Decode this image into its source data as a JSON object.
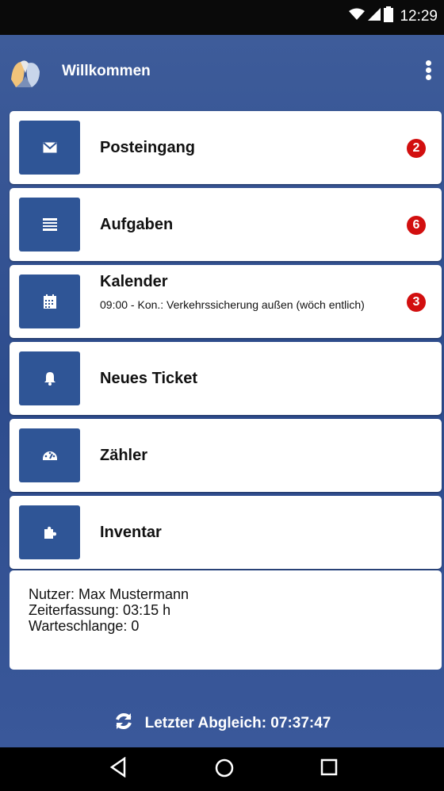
{
  "status_bar": {
    "time": "12:29",
    "icons": [
      "wifi-icon",
      "signal-icon",
      "battery-icon"
    ]
  },
  "app_bar": {
    "title": "Willkommen",
    "logo_icon": "hands-logo-icon",
    "menu_icon": "overflow-menu-icon"
  },
  "menu": [
    {
      "label": "Posteingang",
      "icon": "envelope-icon",
      "badge": "2"
    },
    {
      "label": "Aufgaben",
      "icon": "list-icon",
      "badge": "6"
    },
    {
      "label": "Kalender",
      "icon": "calendar-icon",
      "badge": "3",
      "subtitle": "09:00 - Kon.: Verkehrssicherung außen (wöch entlich)"
    },
    {
      "label": "Neues Ticket",
      "icon": "bell-icon"
    },
    {
      "label": "Zähler",
      "icon": "gauge-icon"
    },
    {
      "label": "Inventar",
      "icon": "puzzle-icon"
    }
  ],
  "info": {
    "user_line": "Nutzer: Max Mustermann",
    "time_line": "Zeiterfassung:  03:15 h",
    "queue_line": "Warteschlange: 0"
  },
  "footer": {
    "sync_icon": "refresh-icon",
    "last_sync": "Letzter Abgleich: 07:37:47"
  },
  "nav": {
    "back": "back-icon",
    "home": "home-icon",
    "recent": "recent-apps-icon"
  },
  "colors": {
    "primary": "#2f5596",
    "badge": "#d20f0f",
    "status_bar": "#0a0a0a"
  }
}
